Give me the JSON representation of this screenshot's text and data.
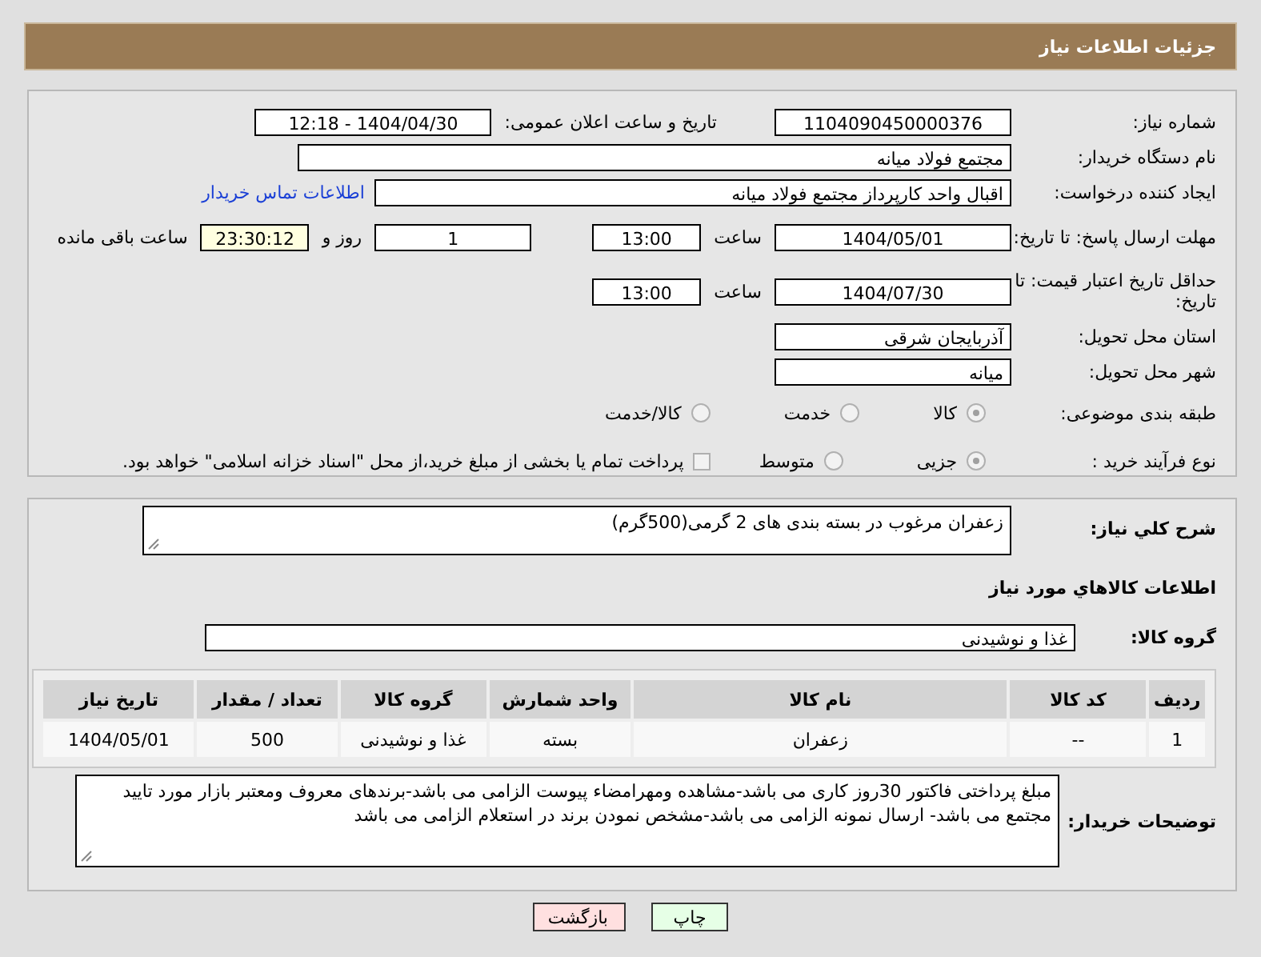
{
  "header": {
    "title": "جزئیات اطلاعات نیاز"
  },
  "need_number": {
    "label": "شماره نیاز:",
    "value": "1104090450000376"
  },
  "announce": {
    "label": "تاریخ و ساعت اعلان عمومی:",
    "value": "1404/04/30 - 12:18"
  },
  "buyer": {
    "label": "نام دستگاه خریدار:",
    "value": "مجتمع فولاد میانه"
  },
  "requester": {
    "label": "ایجاد کننده درخواست:",
    "value": "اقبال واحد کارپرداز مجتمع فولاد میانه",
    "link": "اطلاعات تماس خریدار"
  },
  "reply_deadline": {
    "label": "مهلت ارسال پاسخ: تا تاریخ:",
    "date": "1404/05/01",
    "time_label": "ساعت",
    "time": "13:00",
    "days": "1",
    "days_label": "روز و",
    "remaining": "23:30:12",
    "remaining_label": "ساعت باقی مانده"
  },
  "price_validity": {
    "label": "حداقل تاریخ اعتبار قیمت: تا تاریخ:",
    "date": "1404/07/30",
    "time_label": "ساعت",
    "time": "13:00"
  },
  "province": {
    "label": "استان محل تحویل:",
    "value": "آذربایجان شرقی"
  },
  "city": {
    "label": "شهر محل تحویل:",
    "value": "میانه"
  },
  "category": {
    "label": "طبقه بندی موضوعی:",
    "options": [
      {
        "label": "کالا",
        "selected": true
      },
      {
        "label": "خدمت",
        "selected": false
      },
      {
        "label": "کالا/خدمت",
        "selected": false
      }
    ]
  },
  "process": {
    "label": "نوع فرآیند خرید :",
    "options": [
      {
        "label": "جزیی",
        "selected": true
      },
      {
        "label": "متوسط",
        "selected": false
      }
    ],
    "checkbox": {
      "label": "پرداخت تمام یا بخشی از مبلغ خرید،از محل \"اسناد خزانه اسلامی\" خواهد بود.",
      "checked": false
    }
  },
  "description": {
    "label": "شرح كلي نياز:",
    "value": "زعفران مرغوب در بسته بندی های 2 گرمی(500گرم)"
  },
  "goods_heading": "اطلاعات كالاهاي مورد نياز",
  "goods_group": {
    "label": "گروه كالا:",
    "value": "غذا و نوشیدنی"
  },
  "table": {
    "columns": [
      "ردیف",
      "کد کالا",
      "نام کالا",
      "واحد شمارش",
      "گروه کالا",
      "تعداد / مقدار",
      "تاریخ نیاز"
    ],
    "rows": [
      [
        "1",
        "--",
        "زعفران",
        "بسته",
        "غذا و نوشیدنی",
        "500",
        "1404/05/01"
      ]
    ]
  },
  "buyer_notes": {
    "label": "توضیحات خریدار:",
    "value": "مبلغ پرداختی فاکتور 30روز کاری می باشد-مشاهده ومهرامضاء پیوست الزامی می باشد-برندهای معروف ومعتبر بازار مورد تایید مجتمع می باشد- ارسال نمونه الزامی می باشد-مشخص نمودن برند در استعلام الزامی می باشد"
  },
  "buttons": [
    {
      "label": "چاپ",
      "kind": "print"
    },
    {
      "label": "بازگشت",
      "kind": "back"
    }
  ]
}
